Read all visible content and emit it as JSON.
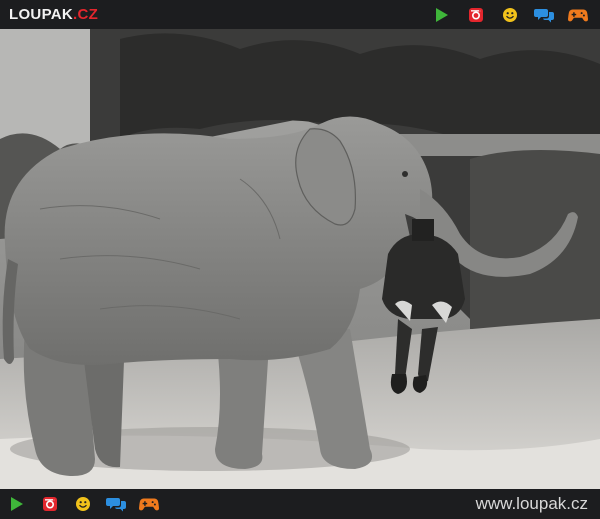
{
  "brand": {
    "name": "LOUPAK",
    "dot": ".",
    "tld": "CZ"
  },
  "top_icons": [
    "play-icon",
    "instagram-icon",
    "smiley-icon",
    "chat-icon",
    "gamepad-icon"
  ],
  "bottom_icons": [
    "play-icon",
    "instagram-icon",
    "smiley-icon",
    "chat-icon",
    "gamepad-icon"
  ],
  "colors": {
    "bar": "#1c1d1f",
    "accent_red": "#e3262d",
    "play_green": "#3fb63a",
    "smiley_yellow": "#f1c21b",
    "chat_blue": "#2c8fe0",
    "gamepad_orange": "#ef7a1d"
  },
  "footer": {
    "url": "www.loupak.cz"
  }
}
